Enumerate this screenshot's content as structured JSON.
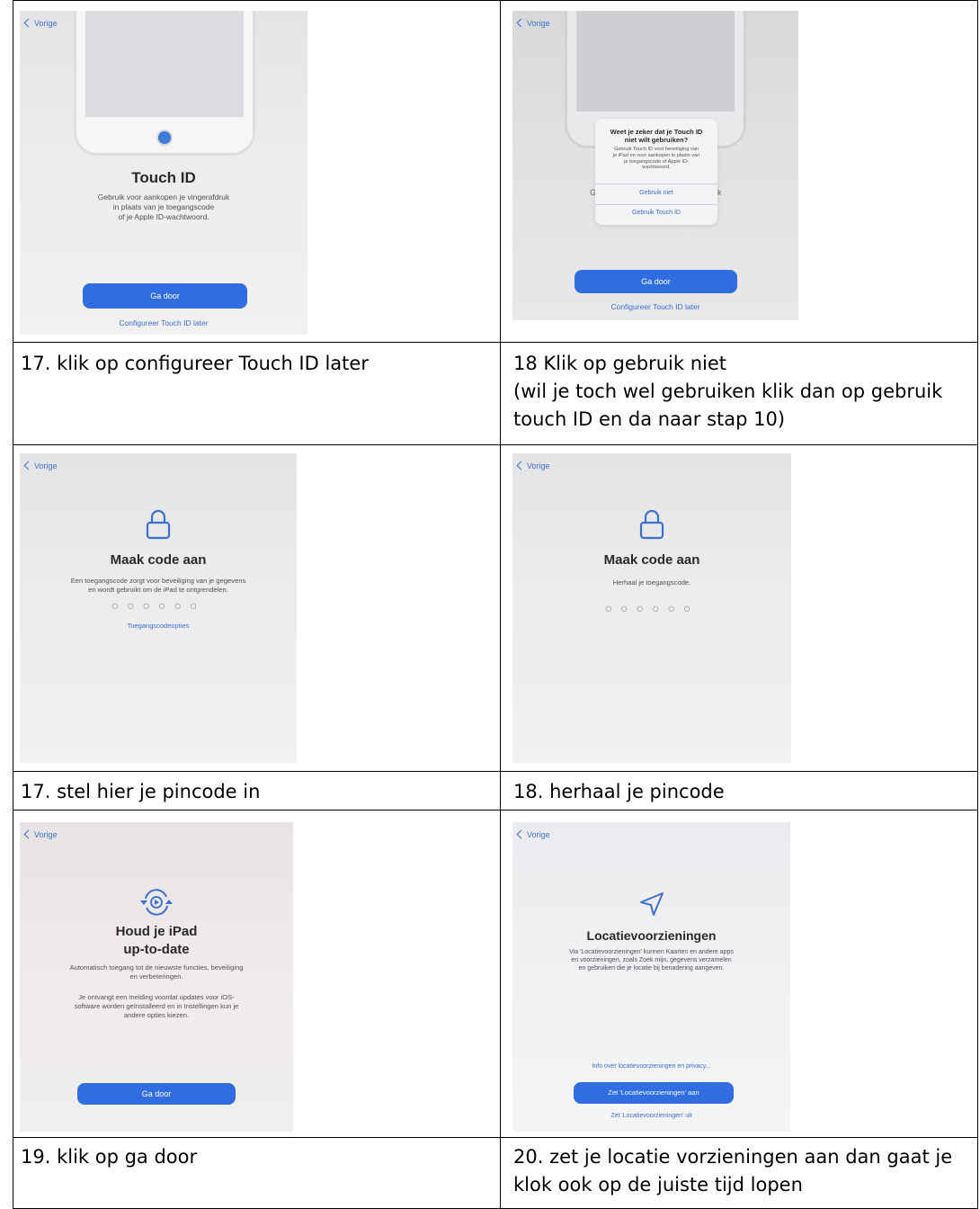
{
  "shot1": {
    "back_label": "Vorige",
    "title": "Touch ID",
    "body": [
      "Gebruik voor aankopen je vingerafdruk",
      "in plaats van je toegangscode",
      "of je Apple ID-wachtwoord."
    ],
    "primary_button": "Ga door",
    "secondary_link": "Configureer Touch ID later"
  },
  "shot2": {
    "back_label": "Vorige",
    "dialog_title": [
      "Weet je zeker dat je Touch ID",
      "niet wilt gebruiken?"
    ],
    "dialog_body": [
      "Gebruik Touch ID voor beveiliging van",
      "je iPad en voor aankopen in plaats van",
      "je toegangscode of Apple ID-",
      "wachtwoord."
    ],
    "dialog_option_1": "Gebruik niet",
    "dialog_option_2": "Gebruik Touch ID",
    "bg_left_fragment": "G",
    "bg_right_fragment": "ik",
    "primary_button": "Ga door",
    "secondary_link": "Configureer Touch ID later"
  },
  "shot3": {
    "back_label": "Vorige",
    "title": "Maak code aan",
    "body": [
      "Een toegangscode zorgt voor beveiliging van je gegevens",
      "en wordt gebruikt om de iPad te ontgrendelen."
    ],
    "code_dots": "○○○○○○",
    "options_link": "Toegangscodeopties"
  },
  "shot4": {
    "back_label": "Vorige",
    "title": "Maak code aan",
    "body": "Herhaal je toegangscode.",
    "code_dots": "○○○○○○"
  },
  "shot5": {
    "back_label": "Vorige",
    "title": [
      "Houd je iPad",
      "up-to-date"
    ],
    "body1": [
      "Automatisch toegang tot de nieuwste functies, beveiliging",
      "en verbeteringen."
    ],
    "body2": [
      "Je ontvangt een melding voordat updates voor iOS-",
      "software worden geïnstalleerd en in Instellingen kun je",
      "andere opties kiezen."
    ],
    "primary_button": "Ga door"
  },
  "shot6": {
    "back_label": "Vorige",
    "title": "Locatievoorzieningen",
    "body": [
      "Via 'Locatievoorzieningen' kunnen Kaarten en andere apps",
      "en voorzieningen, zoals Zoek mijn, gegevens verzamelen",
      "en gebruiken die je locatie bij benadering aangeven."
    ],
    "info_link": "Info over locatievoorzieningen en privacy...",
    "primary_button": "Zet 'Locatievoorzieningen' aan",
    "secondary_link": "Zet 'Locatievoorzieningen' uit"
  },
  "captions": {
    "c17a": "17. klik op configureer Touch ID later",
    "c18a": [
      "18 Klik op gebruik niet",
      "(wil je toch wel gebruiken klik dan op gebruik",
      "touch ID en da naar stap 10)"
    ],
    "c17b": "17. stel hier je pincode in",
    "c18b": "18. herhaal je pincode",
    "c19": "19. klik op ga door",
    "c20": [
      "20. zet je locatie vorzieningen aan dan gaat je",
      "klok ook op de juiste tijd lopen"
    ]
  },
  "colors": {
    "accent": "#2f6de0",
    "link": "#3b6fd0",
    "border": "#000000"
  }
}
